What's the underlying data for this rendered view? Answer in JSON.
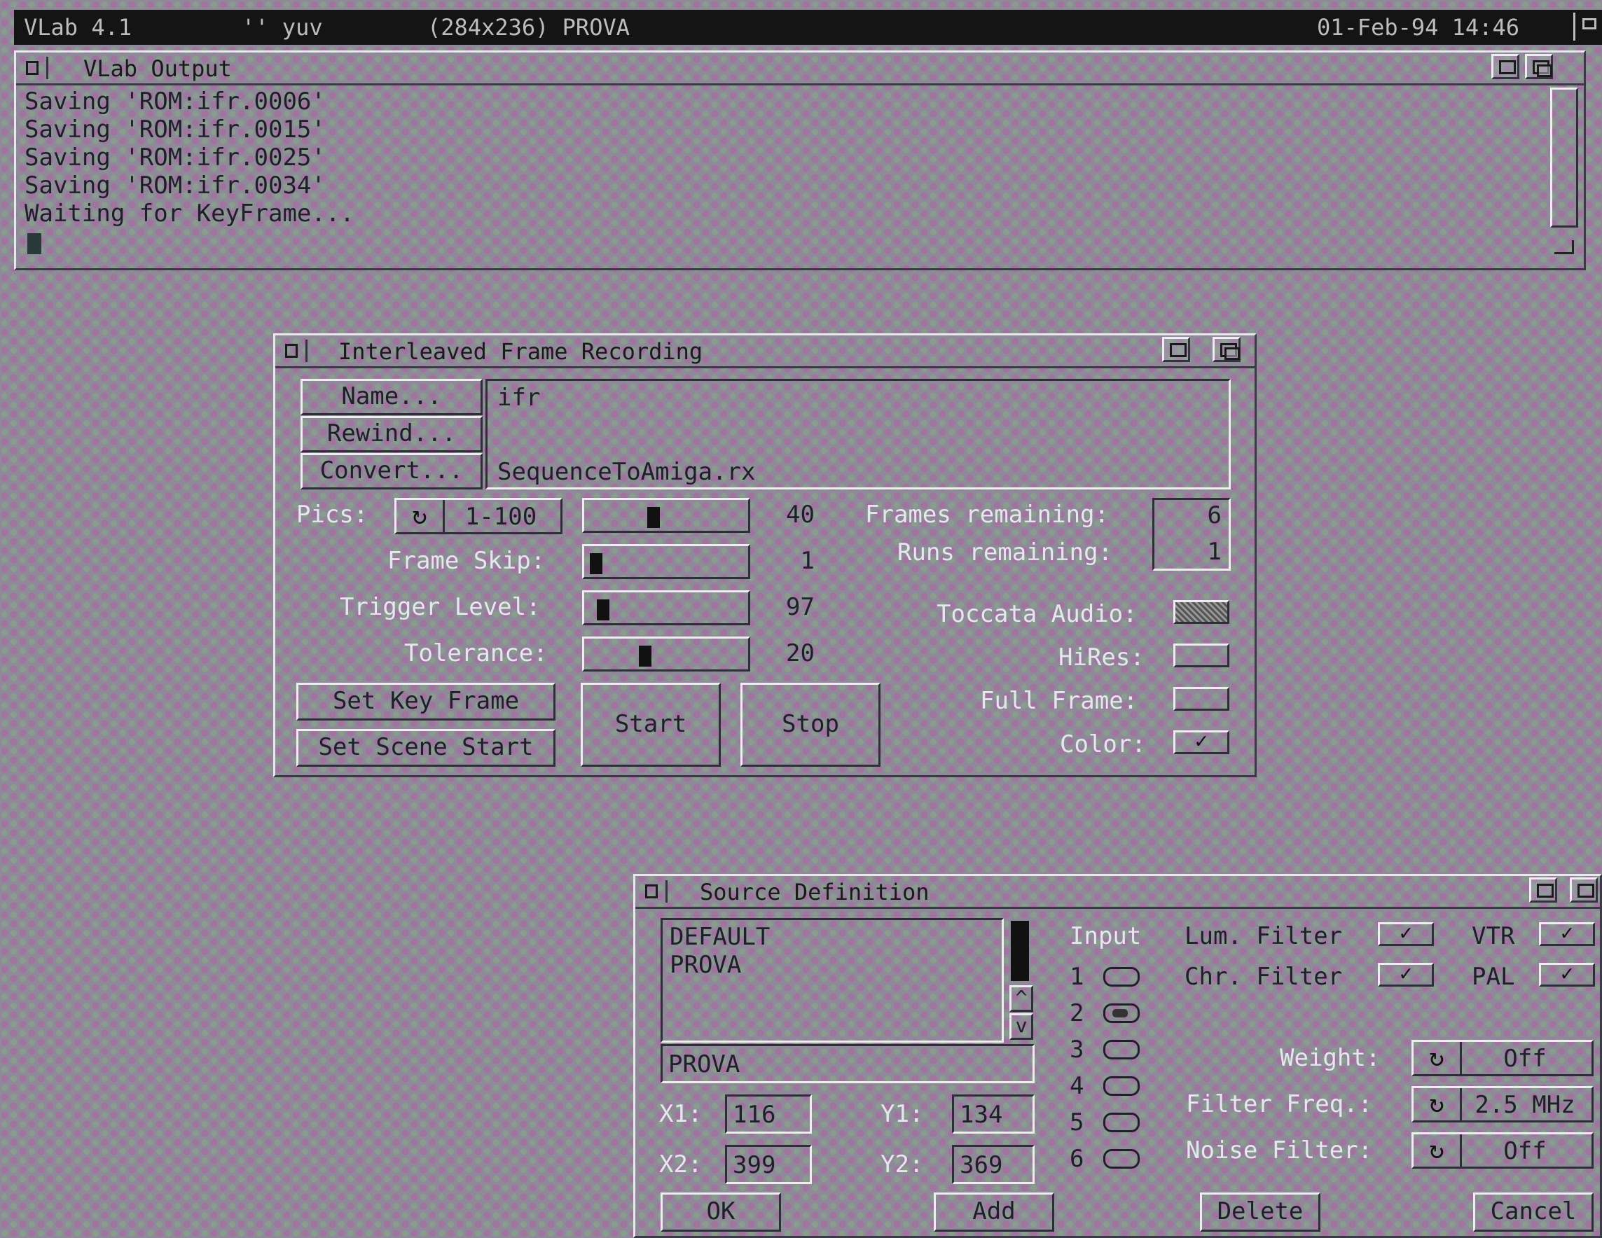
{
  "screen": {
    "app": "VLab 4.1",
    "mode": "'' yuv",
    "info": "(284x236) PROVA",
    "datetime": "01-Feb-94 14:46"
  },
  "output_window": {
    "title": "VLab Output",
    "lines": [
      "Saving 'ROM:ifr.0006'",
      "Saving 'ROM:ifr.0015'",
      "Saving 'ROM:ifr.0025'",
      "Saving 'ROM:ifr.0034'",
      "Waiting for KeyFrame..."
    ]
  },
  "ifr_window": {
    "title": "Interleaved Frame Recording",
    "name_button": "Name...",
    "rewind_button": "Rewind...",
    "convert_button": "Convert...",
    "name_value": "ifr",
    "convert_value": "SequenceToAmiga.rx",
    "pics_label": "Pics:",
    "pics_cycle": "1-100",
    "pics_value": "40",
    "frame_skip_label": "Frame Skip:",
    "frame_skip_value": "1",
    "trigger_label": "Trigger Level:",
    "trigger_value": "97",
    "tolerance_label": "Tolerance:",
    "tolerance_value": "20",
    "slider_levels": {
      "pics": 0.4,
      "frame_skip": 0.0,
      "trigger": 0.05,
      "tolerance": 0.35
    },
    "frames_remaining_label": "Frames remaining:",
    "frames_remaining": "6",
    "runs_remaining_label": "Runs remaining:",
    "runs_remaining": "1",
    "toccata_label": "Toccata Audio:",
    "hires_label": "HiRes:",
    "full_frame_label": "Full Frame:",
    "color_label": "Color:",
    "color_checked": true,
    "set_key_frame": "Set Key Frame",
    "set_scene_start": "Set Scene Start",
    "start": "Start",
    "stop": "Stop",
    "checkmark": "✓"
  },
  "source_window": {
    "title": "Source Definition",
    "list": [
      "DEFAULT",
      "PROVA"
    ],
    "list_selected": "PROVA",
    "input_label": "Input",
    "inputs": [
      "1",
      "2",
      "3",
      "4",
      "5",
      "6"
    ],
    "selected_input": "2",
    "lum_filter": "Lum. Filter",
    "chr_filter": "Chr. Filter",
    "vtr": "VTR",
    "pal": "PAL",
    "weight_label": "Weight:",
    "weight_value": "Off",
    "filter_freq_label": "Filter Freq.:",
    "filter_freq_value": "2.5 MHz",
    "noise_label": "Noise Filter:",
    "noise_value": "Off",
    "x1_label": "X1:",
    "x1": "116",
    "y1_label": "Y1:",
    "y1": "134",
    "x2_label": "X2:",
    "x2": "399",
    "y2_label": "Y2:",
    "y2": "369",
    "ok": "OK",
    "add": "Add",
    "delete": "Delete",
    "cancel": "Cancel",
    "scroll_up": "^",
    "scroll_down": "v"
  }
}
